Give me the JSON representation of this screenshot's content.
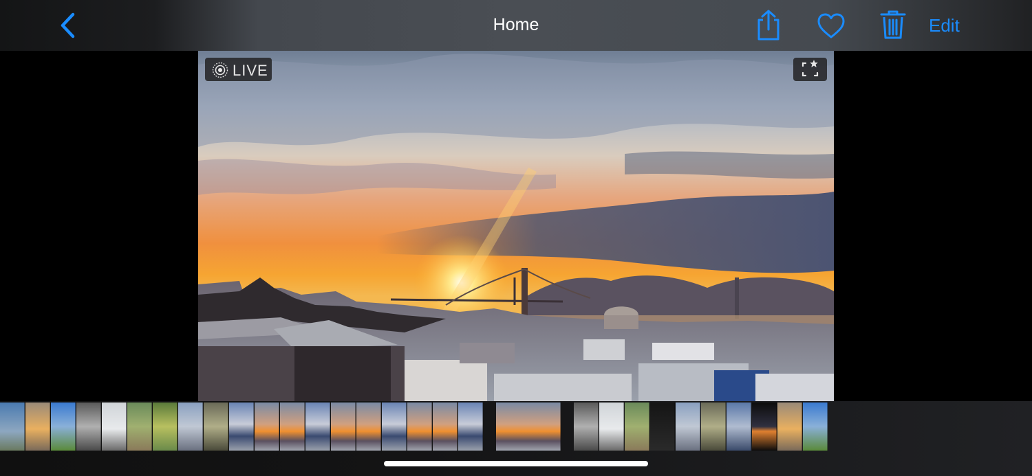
{
  "nav": {
    "title": "Home",
    "edit_label": "Edit",
    "accent_color": "#1a8cff",
    "icons": [
      "chevron-left-icon",
      "share-icon",
      "heart-icon",
      "trash-icon"
    ]
  },
  "photo": {
    "badge_label": "LIVE",
    "live_icon": "live-photo-icon",
    "crop_icon": "crop-star-icon"
  },
  "filmstrip": {
    "thumb_count": 30,
    "selected_index": 19
  }
}
